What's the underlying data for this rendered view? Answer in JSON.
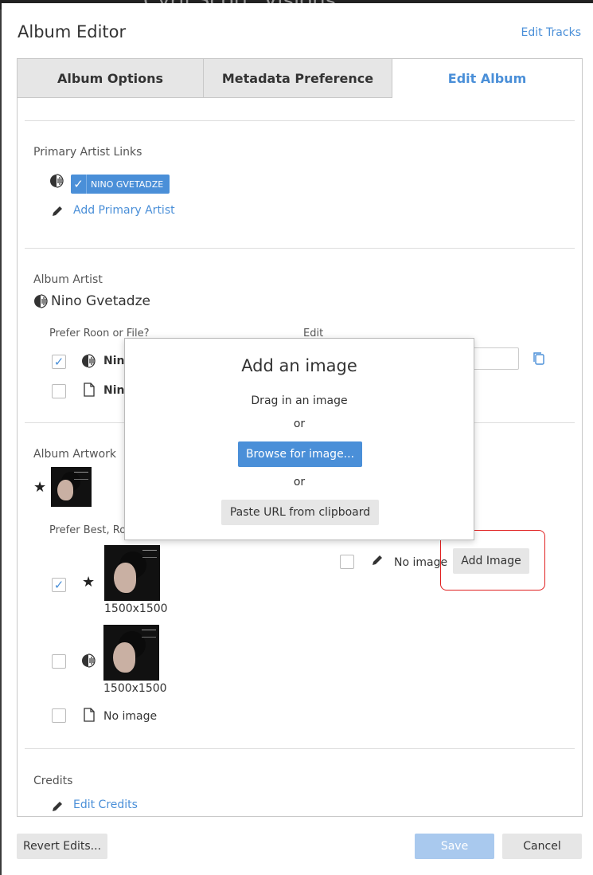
{
  "background": {
    "title": "Cyril Scott: Visions"
  },
  "dialog": {
    "title": "Album Editor",
    "edit_tracks_link": "Edit Tracks",
    "tabs": [
      {
        "label": "Album Options",
        "active": false
      },
      {
        "label": "Metadata Preference",
        "active": false
      },
      {
        "label": "Edit Album",
        "active": true
      }
    ]
  },
  "primary_artist_links": {
    "heading": "Primary Artist Links",
    "chip_label": "NINO GVETADZE",
    "add_link": "Add Primary Artist"
  },
  "album_artist": {
    "heading": "Album Artist",
    "name": "Nino Gvetadze",
    "prefer_label": "Prefer Roon or File?",
    "edit_label": "Edit",
    "rows": [
      {
        "source": "roon",
        "checked": true,
        "value": "Nino Gvetadze",
        "visible": "Nin"
      },
      {
        "source": "file",
        "checked": false,
        "value": "Nino Gvetadze",
        "visible": "Nin"
      }
    ]
  },
  "album_artwork": {
    "heading": "Album Artwork",
    "prefer_label": "Prefer Best, Roo",
    "rows": [
      {
        "source": "best",
        "checked": true,
        "resolution": "1500x1500"
      },
      {
        "source": "roon",
        "checked": false,
        "resolution": "1500x1500"
      },
      {
        "source": "file",
        "checked": false,
        "text": "No image"
      }
    ],
    "edit_column": {
      "text": "No image",
      "button": "Add Image"
    }
  },
  "credits": {
    "heading": "Credits",
    "link": "Edit Credits"
  },
  "footer": {
    "revert": "Revert Edits...",
    "save": "Save",
    "cancel": "Cancel"
  },
  "add_image_modal": {
    "title": "Add an image",
    "drag_text": "Drag in an image",
    "or1": "or",
    "browse_button": "Browse for image...",
    "or2": "or",
    "paste_button": "Paste URL from clipboard"
  },
  "colors": {
    "accent": "#4a8fd8",
    "highlight": "#e02020"
  }
}
